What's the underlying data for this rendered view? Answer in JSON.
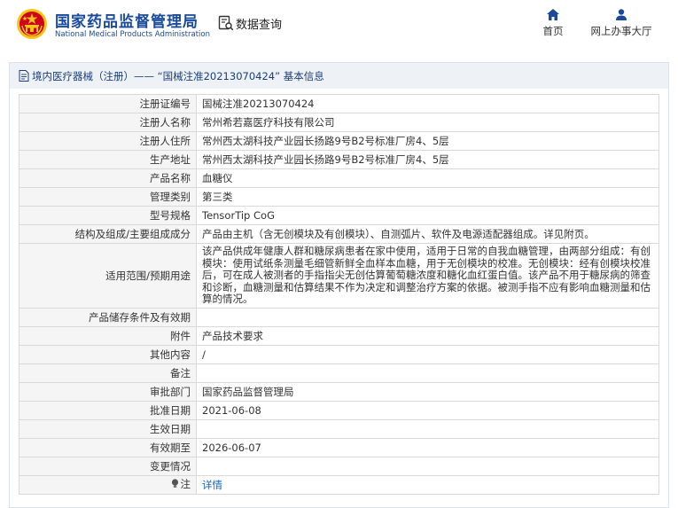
{
  "header": {
    "title": "国家药品监督管理局",
    "subtitle": "National Medical Products Administration",
    "query_label": "数据查询",
    "nav": [
      {
        "label": "首页",
        "icon": "home-icon"
      },
      {
        "label": "网上办事大厅",
        "icon": "user-icon"
      }
    ]
  },
  "breadcrumb": {
    "text": "境内医疗器械（注册）—— “国械注准20213070424” 基本信息",
    "icon": "document-icon"
  },
  "records": [
    {
      "key": "注册证编号",
      "value": "国械注准20213070424"
    },
    {
      "key": "注册人名称",
      "value": "常州希若嘉医疗科技有限公司"
    },
    {
      "key": "注册人住所",
      "value": "常州西太湖科技产业园长扬路9号B2号标准厂房4、5层"
    },
    {
      "key": "生产地址",
      "value": "常州西太湖科技产业园长扬路9号B2号标准厂房4、5层"
    },
    {
      "key": "产品名称",
      "value": "血糖仪"
    },
    {
      "key": "管理类别",
      "value": "第三类"
    },
    {
      "key": "型号规格",
      "value": "TensorTip CoG"
    },
    {
      "key": "结构及组成/主要组成成分",
      "value": "产品由主机（含无创模块及有创模块）、自测弧片、软件及电源适配器组成。详见附页。"
    },
    {
      "key": "适用范围/预期用途",
      "value": "该产品供成年健康人群和糖尿病患者在家中使用，适用于日常的自我血糖管理，由两部分组成：有创模块：使用试纸条测量毛细管新鲜全血样本血糖，用于无创模块的校准。无创模块：经有创模块校准后，可在成人被测者的手指指尖无创估算葡萄糖浓度和糖化血红蛋白值。该产品不用于糖尿病的筛查和诊断，血糖测量和估算结果不作为决定和调整治疗方案的依据。被测手指不应有影响血糖测量和估算的情况。"
    },
    {
      "key": "产品储存条件及有效期",
      "value": ""
    },
    {
      "key": "附件",
      "value": "产品技术要求"
    },
    {
      "key": "其他内容",
      "value": "/"
    },
    {
      "key": "备注",
      "value": ""
    },
    {
      "key": "审批部门",
      "value": "国家药品监督管理局"
    },
    {
      "key": "批准日期",
      "value": "2021-06-08"
    },
    {
      "key": "生效日期",
      "value": ""
    },
    {
      "key": "有效期至",
      "value": "2026-06-07"
    },
    {
      "key": "变更情况",
      "value": ""
    },
    {
      "key": "注",
      "value": "详情",
      "icon": "lightbulb-icon"
    }
  ],
  "colors": {
    "brand": "#1a4a9a",
    "link": "#1565c0",
    "emblem_red": "#d0021b",
    "emblem_gold": "#f5c518"
  }
}
